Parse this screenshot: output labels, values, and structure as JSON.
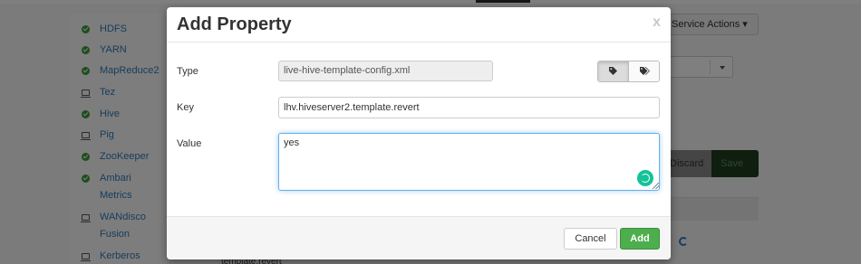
{
  "background": {
    "services": [
      {
        "label": "HDFS",
        "icon": "status-ok-icon"
      },
      {
        "label": "YARN",
        "icon": "status-ok-icon"
      },
      {
        "label": "MapReduce2",
        "icon": "status-ok-icon"
      },
      {
        "label": "Tez",
        "icon": "client-only-icon"
      },
      {
        "label": "Hive",
        "icon": "status-ok-icon"
      },
      {
        "label": "Pig",
        "icon": "client-only-icon"
      },
      {
        "label": "ZooKeeper",
        "icon": "status-ok-icon"
      },
      {
        "label": "Ambari",
        "icon": "status-ok-icon"
      },
      {
        "label": "Metrics",
        "icon": ""
      },
      {
        "label": "WANdisco",
        "icon": "client-only-icon"
      },
      {
        "label": "Fusion",
        "icon": ""
      },
      {
        "label": "Kerberos",
        "icon": "client-only-icon"
      }
    ],
    "service_actions_label": "Service Actions ▾",
    "discard_label": "Discard",
    "save_label": "Save",
    "peek_text": "template.revert"
  },
  "modal": {
    "title": "Add Property",
    "close_label": "x",
    "type_label": "Type",
    "type_value": "live-hive-template-config.xml",
    "key_label": "Key",
    "key_value": "lhv.hiveserver2.template.revert",
    "value_label": "Value",
    "value_value": "yes",
    "cancel_label": "Cancel",
    "add_label": "Add"
  },
  "colors": {
    "add_button": "#4cae4c",
    "focus_border": "#66afe9",
    "link": "#2f7ab8",
    "status_ok": "#3b9d3b"
  }
}
